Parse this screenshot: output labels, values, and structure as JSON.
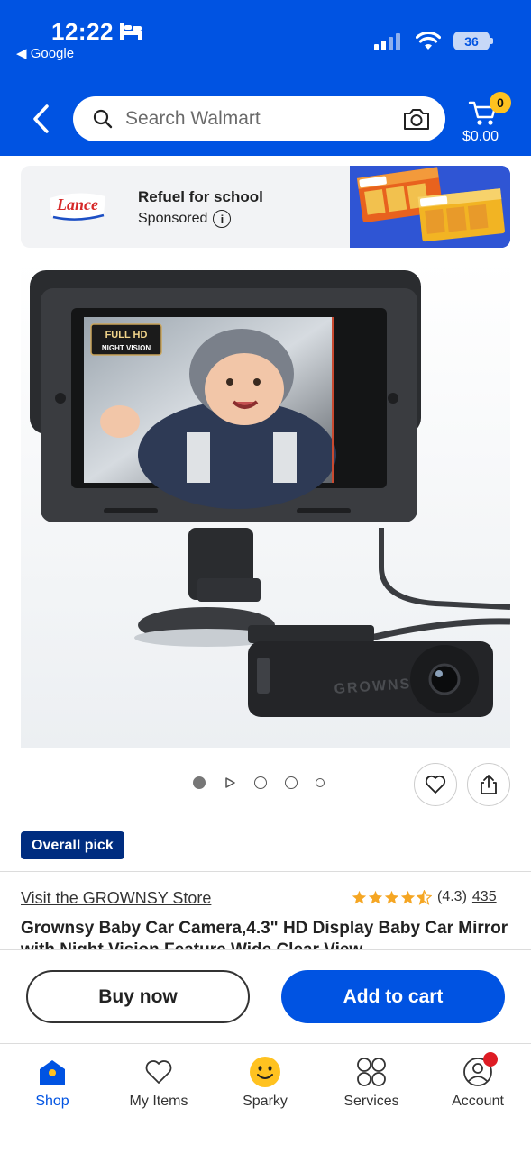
{
  "status_bar": {
    "time": "12:22",
    "back_app": "◀ Google",
    "battery": "36"
  },
  "header": {
    "search_placeholder": "Search Walmart",
    "cart_count": "0",
    "cart_total": "$0.00"
  },
  "sponsored": {
    "title": "Refuel for school",
    "label": "Sponsored",
    "info": "i",
    "brand": "Lance"
  },
  "product": {
    "screen_badge_1": "FULL HD",
    "screen_badge_2": "NIGHT VISION",
    "camera_brand": "GROWNSY",
    "badge": "Overall pick",
    "store_link": "Visit the GROWNSY Store",
    "rating": 4.3,
    "rating_text": "(4.3)",
    "review_count": "435",
    "title": "Grownsy Baby Car Camera,4.3\" HD Display Baby Car Mirror with Night Vision Feature Wide Clear View"
  },
  "actions": {
    "buy_now": "Buy now",
    "add_to_cart": "Add to cart"
  },
  "tabs": [
    {
      "label": "Shop",
      "icon": "shop-icon",
      "active": true
    },
    {
      "label": "My Items",
      "icon": "heart-icon",
      "active": false
    },
    {
      "label": "Sparky",
      "icon": "sparky-icon",
      "active": false
    },
    {
      "label": "Services",
      "icon": "services-icon",
      "active": false
    },
    {
      "label": "Account",
      "icon": "account-icon",
      "active": false
    }
  ],
  "colors": {
    "brand_blue": "#0053e2",
    "spark_yellow": "#ffc220",
    "badge_navy": "#002d80",
    "alert_red": "#de1c24"
  }
}
